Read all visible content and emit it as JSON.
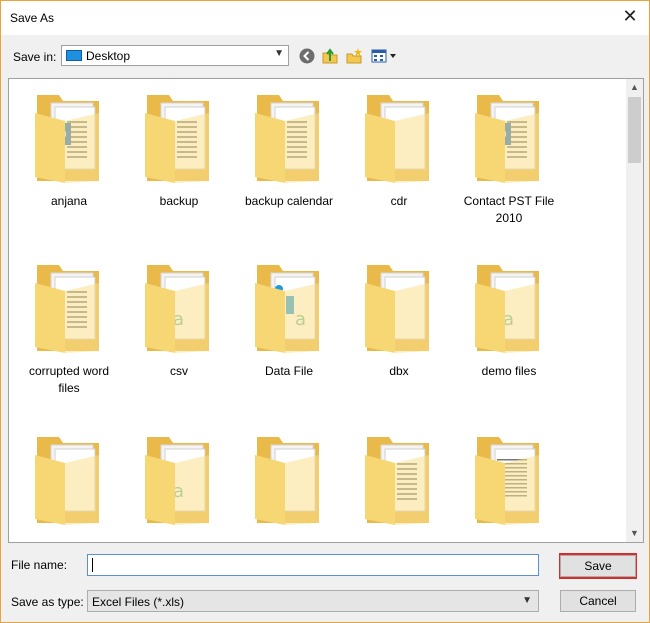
{
  "window": {
    "title": "Save As"
  },
  "toolbar": {
    "save_in_label": "Save in:",
    "location": "Desktop"
  },
  "files": [
    {
      "label": "anjana"
    },
    {
      "label": "backup"
    },
    {
      "label": "backup calendar"
    },
    {
      "label": "cdr"
    },
    {
      "label": "Contact PST File 2010"
    },
    {
      "label": "corrupted word files"
    },
    {
      "label": "csv"
    },
    {
      "label": "Data File"
    },
    {
      "label": "dbx"
    },
    {
      "label": "demo files"
    },
    {
      "label": ""
    },
    {
      "label": ""
    },
    {
      "label": ""
    },
    {
      "label": ""
    },
    {
      "label": ""
    }
  ],
  "form": {
    "file_name_label": "File name:",
    "file_name_value": "",
    "save_as_type_label": "Save as type:",
    "save_as_type_value": "Excel Files (*.xls)"
  },
  "buttons": {
    "save": "Save",
    "cancel": "Cancel"
  },
  "colors": {
    "accent_border": "#e8a33d",
    "highlight": "#d62c2c",
    "folder": "#f7d774"
  }
}
